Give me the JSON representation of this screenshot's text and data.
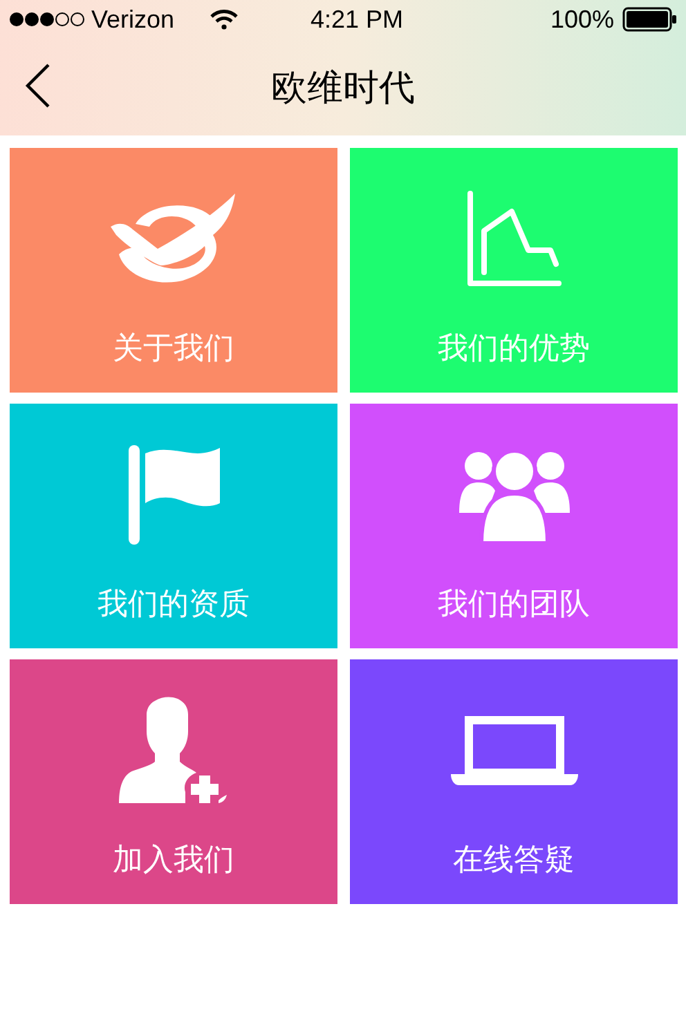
{
  "status_bar": {
    "carrier": "Verizon",
    "time": "4:21 PM",
    "battery": "100%"
  },
  "nav_bar": {
    "title": "欧维时代"
  },
  "tiles": [
    {
      "label": "关于我们",
      "color": "#fb8a66"
    },
    {
      "label": "我们的优势",
      "color": "#1dfc70"
    },
    {
      "label": "我们的资质",
      "color": "#00c9d5"
    },
    {
      "label": "我们的团队",
      "color": "#d14ffc"
    },
    {
      "label": "加入我们",
      "color": "#dc4789"
    },
    {
      "label": "在线答疑",
      "color": "#7b48fc"
    }
  ]
}
